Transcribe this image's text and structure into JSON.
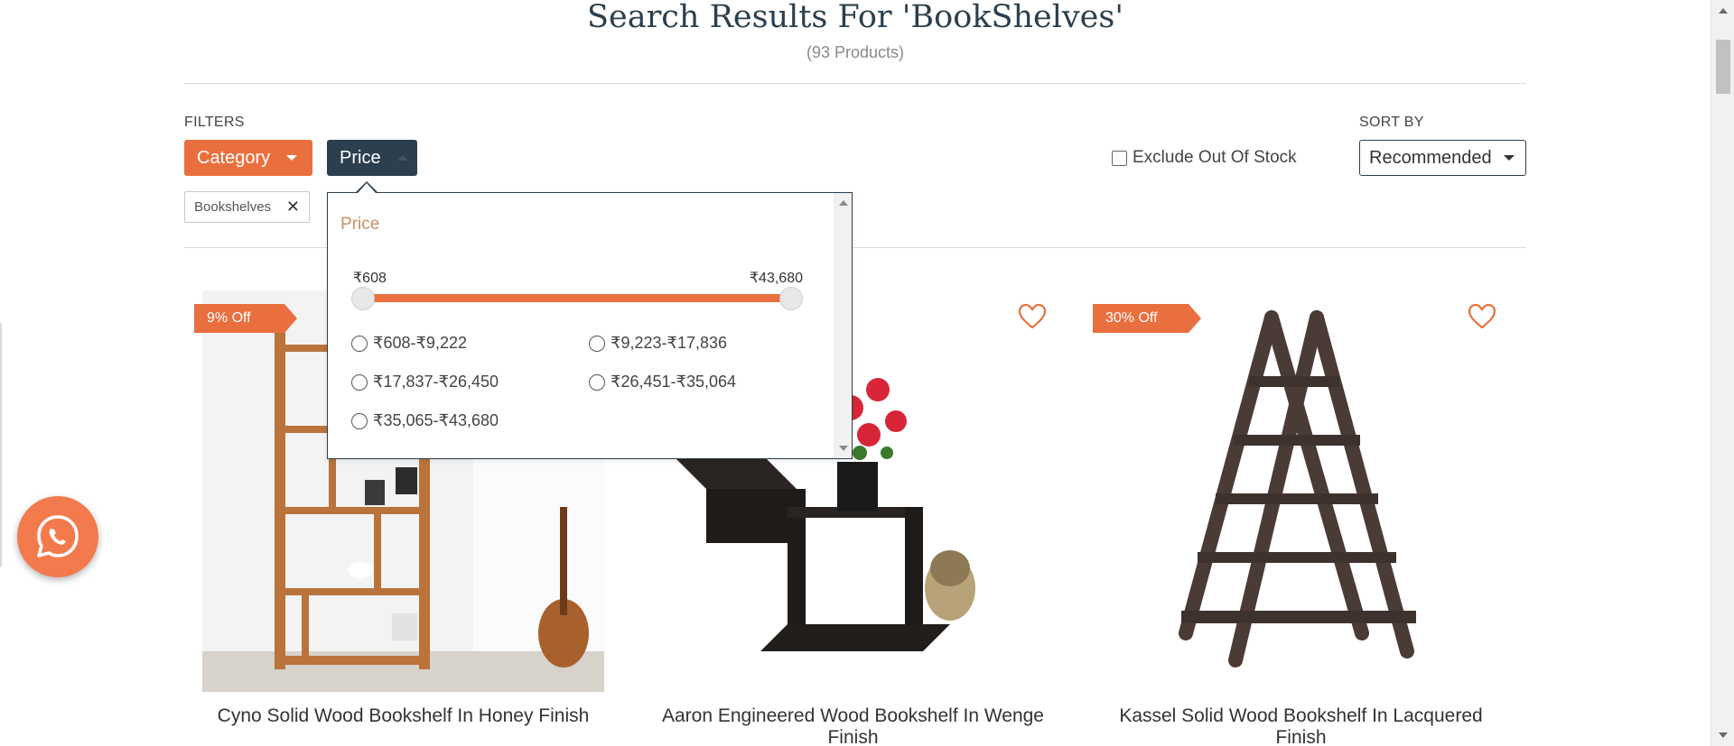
{
  "header": {
    "title": "Search Results For 'BookShelves'",
    "count": "(93 Products)"
  },
  "filters": {
    "label": "FILTERS",
    "category_label": "Category",
    "price_label": "Price",
    "active_chip": "Bookshelves",
    "exclude_out_of_stock": "Exclude Out Of Stock",
    "exclude_checked": false
  },
  "sort": {
    "label": "SORT BY",
    "selected": "Recommended"
  },
  "price_dropdown": {
    "title": "Price",
    "min": "₹608",
    "max": "₹43,680",
    "ranges": [
      "₹608-₹9,222",
      "₹9,223-₹17,836",
      "₹17,837-₹26,450",
      "₹26,451-₹35,064",
      "₹35,065-₹43,680"
    ]
  },
  "products": [
    {
      "name": "Cyno Solid Wood Bookshelf In Honey Finish",
      "badge": "9% Off"
    },
    {
      "name": "Aaron Engineered Wood Bookshelf In Wenge Finish",
      "badge": ""
    },
    {
      "name": "Kassel Solid Wood Bookshelf In Lacquered Finish",
      "badge": "30% Off"
    }
  ],
  "colors": {
    "accent": "#e9703e",
    "navy": "#2b3f4e",
    "price_title": "#c89063"
  },
  "icons": {
    "wishlist": "heart-icon",
    "chip_remove": "close-icon",
    "whatsapp": "whatsapp-icon"
  }
}
